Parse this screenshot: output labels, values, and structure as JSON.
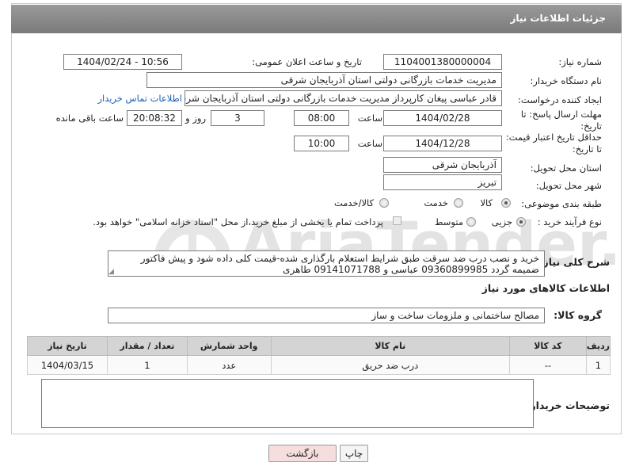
{
  "page": {
    "title": "جزئیات اطلاعات نیاز"
  },
  "fields": {
    "need_number": {
      "label": "شماره نیاز:",
      "value": "1104001380000004"
    },
    "announce_datetime": {
      "label": "تاریخ و ساعت اعلان عمومی:",
      "value": "1404/02/24 - 10:56"
    },
    "buyer_org": {
      "label": "نام دستگاه خریدار:",
      "value": "مدیریت خدمات بازرگانی دولتی استان آذربایجان شرقی"
    },
    "requester": {
      "label": "ایجاد کننده درخواست:",
      "value": "قادر عباسی پیغان کارپرداز مدیریت خدمات بازرگانی دولتی استان آذربایجان شرقی",
      "contact_link": "اطلاعات تماس خریدار"
    },
    "reply_deadline": {
      "label": "مهلت ارسال پاسخ: تا تاریخ:",
      "date": "1404/02/28",
      "time_label": "ساعت",
      "time": "08:00",
      "days": "3",
      "days_label": "روز و",
      "remaining": "20:08:32",
      "remaining_label": "ساعت باقی مانده"
    },
    "price_validity": {
      "label": "حداقل تاریخ اعتبار قیمت: تا تاریخ:",
      "date": "1404/12/28",
      "time_label": "ساعت",
      "time": "10:00"
    },
    "delivery_province": {
      "label": "استان محل تحویل:",
      "value": "آذربایجان شرقی"
    },
    "delivery_city": {
      "label": "شهر محل تحویل:",
      "value": "تبریز"
    },
    "category": {
      "label": "طبقه بندی موضوعی:",
      "options": [
        "کالا",
        "خدمت",
        "کالا/خدمت"
      ],
      "selected": 0
    },
    "purchase_process": {
      "label": "نوع فرآیند خرید :",
      "options": [
        "جزیی",
        "متوسط"
      ],
      "selected": 0,
      "payment_note": "پرداخت تمام یا بخشی از مبلغ خرید،از محل \"اسناد خزانه اسلامی\" خواهد بود."
    }
  },
  "description": {
    "label": "شرح کلی نیاز:",
    "text": "خرید و نصب درب ضد سرقت طبق شرایط استعلام بارگذاری شده-قیمت کلی داده شود و پیش فاکتور ضمیمه گردد 09360899985 عباسی و  09141071788 طاهری"
  },
  "goods": {
    "section_title": "اطلاعات کالاهای مورد نیاز",
    "group_label": "گروه کالا:",
    "group_value": "مصالح ساختمانی و ملزومات ساخت و ساز",
    "columns": [
      "ردیف",
      "کد کالا",
      "نام کالا",
      "واحد شمارش",
      "تعداد / مقدار",
      "تاریخ نیاز"
    ],
    "rows": [
      [
        "1",
        "--",
        "درب ضد حریق",
        "عدد",
        "1",
        "1404/03/15"
      ]
    ]
  },
  "notes": {
    "label": "توضیحات خریدار:"
  },
  "buttons": {
    "print": "چاپ",
    "back": "بازگشت"
  },
  "watermark": {
    "text": "AriaTender.neT"
  }
}
